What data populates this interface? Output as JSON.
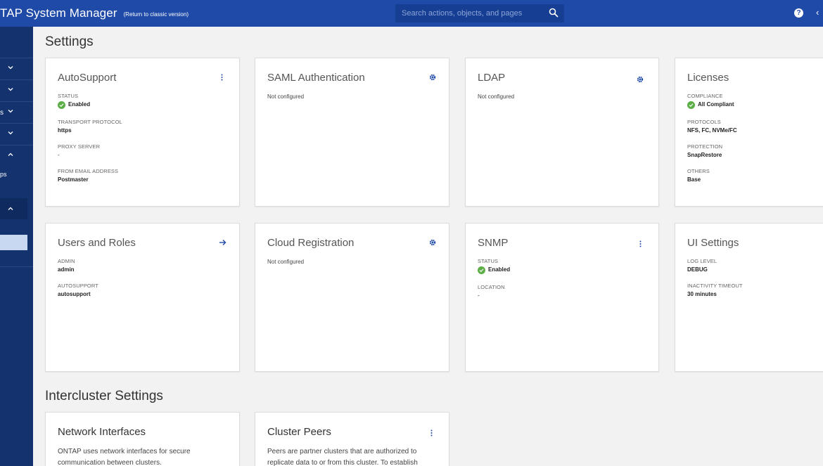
{
  "header": {
    "app_title": "TAP System Manager",
    "classic_link": "(Return to classic version)",
    "search_placeholder": "Search actions, objects, and pages",
    "help_glyph": "?",
    "back_glyph": "‹"
  },
  "sidebar": {
    "items": [
      {
        "label": ""
      },
      {
        "label": ""
      },
      {
        "label": "s"
      },
      {
        "label": ""
      },
      {
        "label": ""
      }
    ],
    "sub_label": "ps"
  },
  "settings": {
    "title": "Settings",
    "autosupport": {
      "title": "AutoSupport",
      "status_label": "STATUS",
      "status_value": "Enabled",
      "transport_label": "TRANSPORT PROTOCOL",
      "transport_value": "https",
      "proxy_label": "PROXY SERVER",
      "proxy_value": "-",
      "from_email_label": "FROM EMAIL ADDRESS",
      "from_email_value": "Postmaster"
    },
    "saml": {
      "title": "SAML Authentication",
      "status_text": "Not configured"
    },
    "ldap": {
      "title": "LDAP",
      "status_text": "Not configured"
    },
    "licenses": {
      "title": "Licenses",
      "compliance_label": "COMPLIANCE",
      "compliance_value": "All Compliant",
      "protocols_label": "PROTOCOLS",
      "protocols_value": "NFS, FC, NVMe/FC",
      "protection_label": "PROTECTION",
      "protection_value": "SnapRestore",
      "others_label": "OTHERS",
      "others_value": "Base"
    },
    "users_roles": {
      "title": "Users and Roles",
      "admin_label": "ADMIN",
      "admin_value": "admin",
      "autosupport_label": "AUTOSUPPORT",
      "autosupport_value": "autosupport"
    },
    "cloud_registration": {
      "title": "Cloud Registration",
      "status_text": "Not configured"
    },
    "snmp": {
      "title": "SNMP",
      "status_label": "STATUS",
      "status_value": "Enabled",
      "location_label": "LOCATION",
      "location_value": "-"
    },
    "ui_settings": {
      "title": "UI Settings",
      "log_level_label": "LOG LEVEL",
      "log_level_value": "DEBUG",
      "timeout_label": "INACTIVITY TIMEOUT",
      "timeout_value": "30 minutes"
    }
  },
  "intercluster": {
    "title": "Intercluster Settings",
    "network_interfaces": {
      "title": "Network Interfaces",
      "description": "ONTAP uses network interfaces for secure communication between clusters."
    },
    "cluster_peers": {
      "title": "Cluster Peers",
      "description": "Peers are partner clusters that are authorized to replicate data to or from this cluster. To establish"
    }
  },
  "colors": {
    "header": "#1f4aa8",
    "sidebar": "#14336e",
    "accent": "#1f4aa8",
    "success": "#5cae47"
  },
  "icons": [
    "search-icon",
    "help-icon",
    "kebab-menu-icon",
    "gear-icon",
    "arrow-right-icon",
    "check-circle-icon",
    "chevron-down-icon",
    "chevron-up-icon"
  ]
}
